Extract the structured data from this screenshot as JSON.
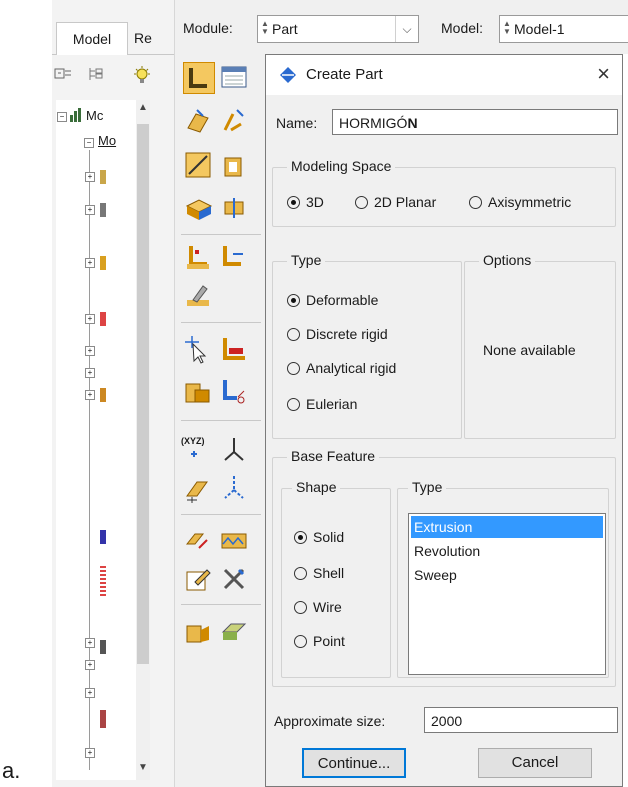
{
  "caption": "a.",
  "tree_pane": {
    "tabs": [
      "Model",
      "Re"
    ],
    "root_label": "Mc",
    "child_label": "Mo"
  },
  "module_bar": {
    "module_label": "Module:",
    "module_value": "Part",
    "model_label": "Model:",
    "model_value": "Model-1"
  },
  "dialog": {
    "title": "Create Part",
    "close_glyph": "×",
    "name_label": "Name:",
    "name_value_plain": "HORMIGÓ",
    "name_value_bold": "N",
    "modeling_space": {
      "title": "Modeling Space",
      "options": [
        "3D",
        "2D Planar",
        "Axisymmetric"
      ],
      "selected": "3D"
    },
    "type": {
      "title": "Type",
      "options": [
        "Deformable",
        "Discrete rigid",
        "Analytical rigid",
        "Eulerian"
      ],
      "selected": "Deformable"
    },
    "options_group": {
      "title": "Options",
      "text": "None available"
    },
    "base_feature": {
      "title": "Base Feature",
      "shape": {
        "title": "Shape",
        "options": [
          "Solid",
          "Shell",
          "Wire",
          "Point"
        ],
        "selected": "Solid"
      },
      "type": {
        "title": "Type",
        "items": [
          "Extrusion",
          "Revolution",
          "Sweep"
        ],
        "selected": "Extrusion"
      }
    },
    "approx_size_label": "Approximate size:",
    "approx_size_value": "2000",
    "continue_label": "Continue...",
    "cancel_label": "Cancel"
  },
  "colors": {
    "selection": "#3399ff",
    "default_button_border": "#0078d7",
    "window_bg": "#f0f0f0"
  }
}
